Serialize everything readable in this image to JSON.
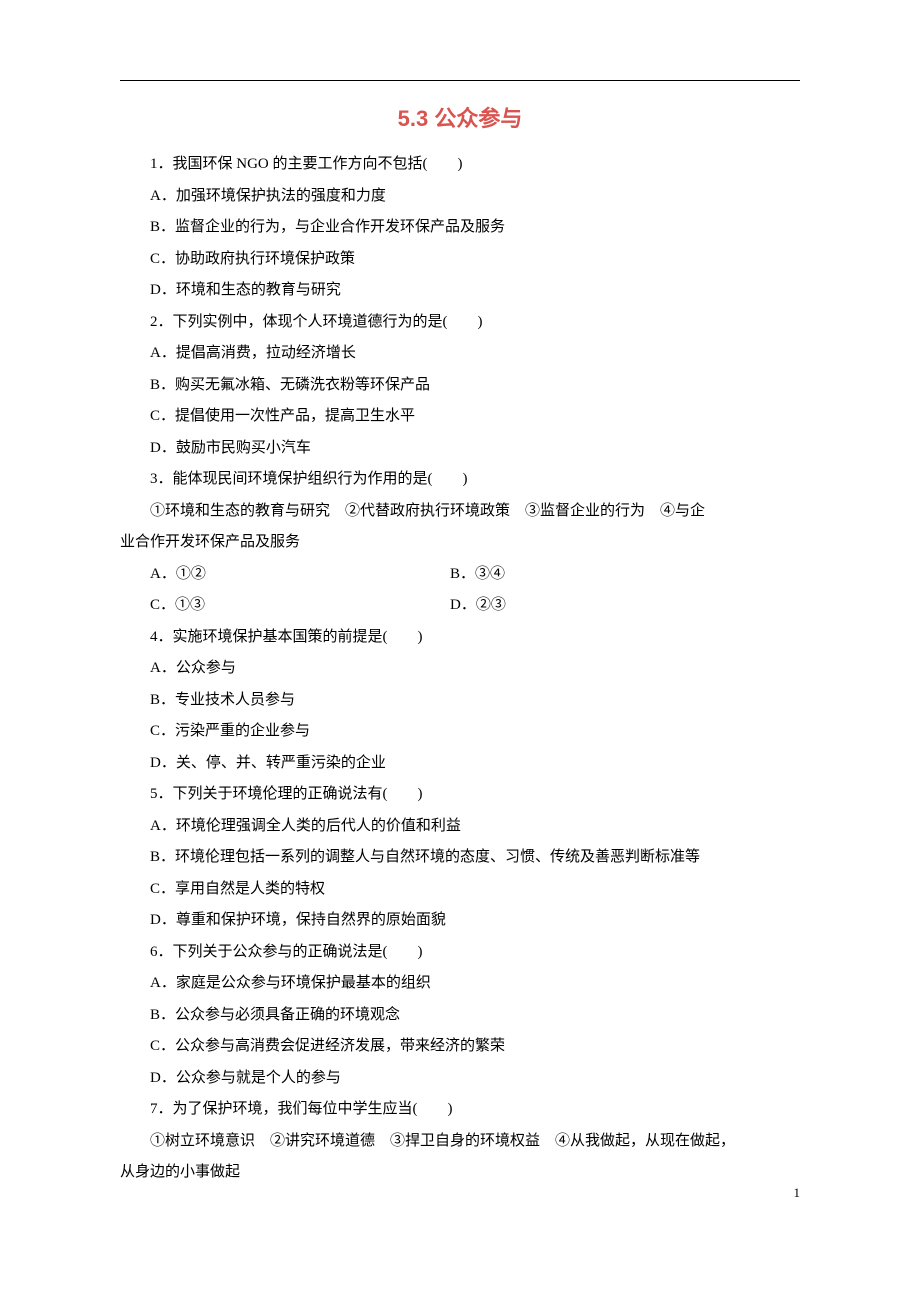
{
  "title": "5.3 公众参与",
  "page_number": "1",
  "questions": [
    {
      "stem": "1．我国环保 NGO 的主要工作方向不包括(　　)",
      "options": [
        "A．加强环境保护执法的强度和力度",
        "B．监督企业的行为，与企业合作开发环保产品及服务",
        "C．协助政府执行环境保护政策",
        "D．环境和生态的教育与研究"
      ]
    },
    {
      "stem": "2．下列实例中，体现个人环境道德行为的是(　　)",
      "options": [
        "A．提倡高消费，拉动经济增长",
        "B．购买无氟冰箱、无磷洗衣粉等环保产品",
        "C．提倡使用一次性产品，提高卫生水平",
        "D．鼓励市民购买小汽车"
      ]
    },
    {
      "stem": "3．能体现民间环境保护组织行为作用的是(　　)",
      "stem2_line1": "①环境和生态的教育与研究　②代替政府执行环境政策　③监督企业的行为　④与企",
      "stem2_line2": "业合作开发环保产品及服务",
      "options_two_col": [
        {
          "left": "A．①②",
          "right": "B．③④"
        },
        {
          "left": "C．①③",
          "right": "D．②③"
        }
      ]
    },
    {
      "stem": "4．实施环境保护基本国策的前提是(　　)",
      "options": [
        "A．公众参与",
        "B．专业技术人员参与",
        "C．污染严重的企业参与",
        "D．关、停、并、转严重污染的企业"
      ]
    },
    {
      "stem": "5．下列关于环境伦理的正确说法有(　　)",
      "options": [
        "A．环境伦理强调全人类的后代人的价值和利益",
        "B．环境伦理包括一系列的调整人与自然环境的态度、习惯、传统及善恶判断标准等",
        "C．享用自然是人类的特权",
        "D．尊重和保护环境，保持自然界的原始面貌"
      ]
    },
    {
      "stem": "6．下列关于公众参与的正确说法是(　　)",
      "options": [
        "A．家庭是公众参与环境保护最基本的组织",
        "B．公众参与必须具备正确的环境观念",
        "C．公众参与高消费会促进经济发展，带来经济的繁荣",
        "D．公众参与就是个人的参与"
      ]
    },
    {
      "stem": "7．为了保护环境，我们每位中学生应当(　　)",
      "stem2_line1": "①树立环境意识　②讲究环境道德　③捍卫自身的环境权益　④从我做起，从现在做起，",
      "stem2_line2": "从身边的小事做起"
    }
  ]
}
